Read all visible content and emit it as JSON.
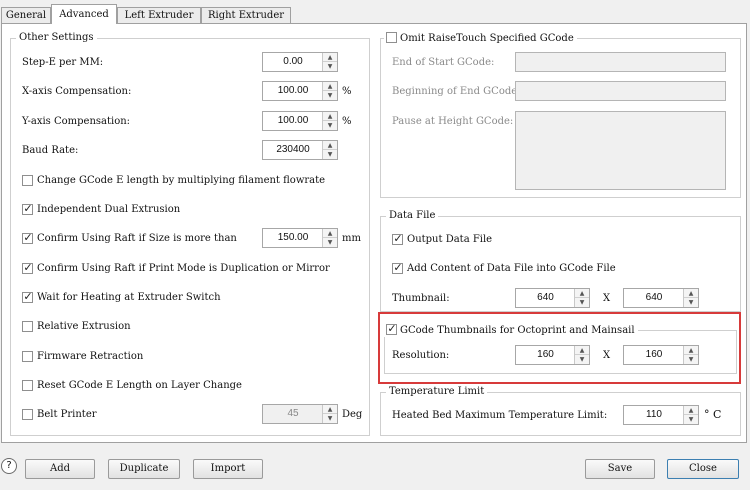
{
  "tabs": [
    "General",
    "Advanced",
    "Left Extruder",
    "Right Extruder"
  ],
  "other_settings": {
    "title": "Other Settings",
    "step_e_label": "Step-E per MM:",
    "step_e_value": "0.00",
    "x_comp_label": "X-axis Compensation:",
    "x_comp_value": "100.00",
    "x_comp_unit": "%",
    "y_comp_label": "Y-axis Compensation:",
    "y_comp_value": "100.00",
    "y_comp_unit": "%",
    "baud_label": "Baud Rate:",
    "baud_value": "230400",
    "change_gcode_label": "Change GCode E length by multiplying filament flowrate",
    "change_gcode_checked": false,
    "dual_extrusion_label": "Independent Dual Extrusion",
    "dual_extrusion_checked": true,
    "raft_size_label": "Confirm Using Raft if Size is more than",
    "raft_size_checked": true,
    "raft_size_value": "150.00",
    "raft_size_unit": "mm",
    "raft_mode_label": "Confirm Using Raft if Print Mode is Duplication or Mirror",
    "raft_mode_checked": true,
    "wait_heating_label": "Wait for Heating at Extruder Switch",
    "wait_heating_checked": true,
    "relative_label": "Relative Extrusion",
    "relative_checked": false,
    "firmware_label": "Firmware Retraction",
    "firmware_checked": false,
    "reset_gcode_label": "Reset GCode E Length on Layer Change",
    "reset_gcode_checked": false,
    "belt_label": "Belt Printer",
    "belt_checked": false,
    "belt_value": "45",
    "belt_unit": "Deg"
  },
  "omit_gcode": {
    "title": "Omit RaiseTouch Specified GCode",
    "checked": false,
    "end_start_label": "End of Start GCode:",
    "begin_end_label": "Beginning of End GCode:",
    "pause_label": "Pause at Height GCode:"
  },
  "data_file": {
    "title": "Data File",
    "output_label": "Output Data File",
    "output_checked": true,
    "add_content_label": "Add Content of Data File into GCode File",
    "add_content_checked": true,
    "thumbnail_label": "Thumbnail:",
    "thumb_w": "640",
    "thumb_x": "X",
    "thumb_h": "640"
  },
  "octoprint": {
    "title": "GCode Thumbnails for Octoprint and Mainsail",
    "checked": true,
    "resolution_label": "Resolution:",
    "res_w": "160",
    "res_x": "X",
    "res_h": "160"
  },
  "temperature": {
    "title": "Temperature Limit",
    "bed_label": "Heated Bed Maximum Temperature Limit:",
    "bed_value": "110",
    "bed_unit": "° C"
  },
  "footer": {
    "help": "?",
    "add": "Add",
    "duplicate": "Duplicate",
    "import": "Import",
    "save": "Save",
    "close": "Close"
  },
  "colors": {
    "highlight_box": "#d73a3a"
  }
}
